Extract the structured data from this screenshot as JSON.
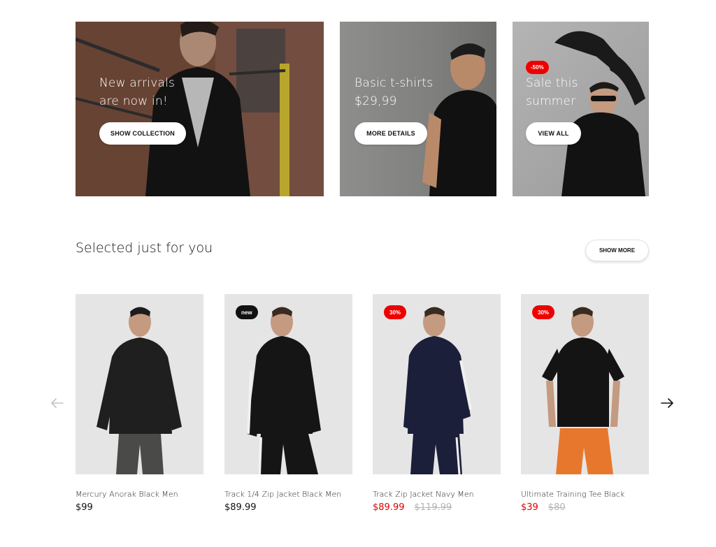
{
  "banners": [
    {
      "title_lines": [
        "New arrivals",
        "are now in!"
      ],
      "button_label": "SHOW COLLECTION"
    },
    {
      "title_lines": [
        "Basic t-shirts",
        "$29,99"
      ],
      "button_label": "MORE DETAILS"
    },
    {
      "badge": "-50%",
      "title_lines": [
        "Sale this",
        "summer"
      ],
      "button_label": "VIEW ALL"
    }
  ],
  "section": {
    "title": "Selected just for you",
    "show_more_label": "SHOW MORE"
  },
  "products": [
    {
      "name": "Mercury Anorak Black Men",
      "price": "$99",
      "garment_color": "#1f1f1f",
      "pants_color": "#4a4a48"
    },
    {
      "tag": "new",
      "name": "Track 1/4 Zip Jacket Black Men",
      "price": "$89.99",
      "garment_color": "#151515",
      "pants_color": "#151515"
    },
    {
      "tag": "30%",
      "name": "Track Zip Jacket Navy Men",
      "price": "$89.99",
      "old_price": "$119.99",
      "garment_color": "#1b1f3a",
      "pants_color": "#1b1f3a"
    },
    {
      "tag": "30%",
      "name": "Ultimate Training Tee Black",
      "price": "$39",
      "old_price": "$80",
      "garment_color": "#141414",
      "pants_color": "#e8772e"
    }
  ],
  "carousel": {
    "prev_icon": "arrow-left-icon",
    "next_icon": "arrow-right-icon"
  },
  "colors": {
    "sale": "#ee0000",
    "new_tag": "#111111",
    "product_bg": "#e5e5e5"
  }
}
